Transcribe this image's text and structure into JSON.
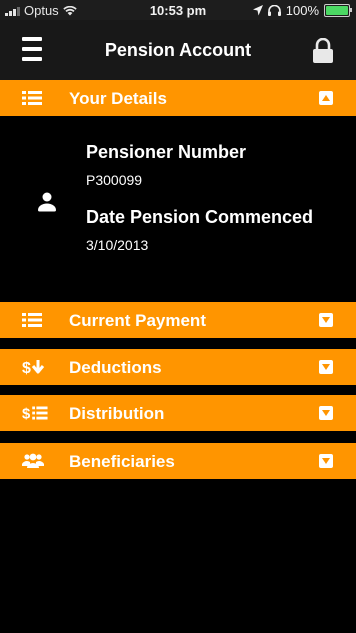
{
  "status_bar": {
    "carrier": "Optus",
    "time": "10:53 pm",
    "battery": "100%"
  },
  "nav": {
    "title": "Pension Account"
  },
  "sections": {
    "your_details": {
      "label": "Your Details",
      "expanded": true,
      "fields": {
        "pensioner_number_label": "Pensioner Number",
        "pensioner_number_value": "P300099",
        "date_commenced_label": "Date Pension Commenced",
        "date_commenced_value": "3/10/2013"
      }
    },
    "current_payment": {
      "label": "Current Payment",
      "expanded": false
    },
    "deductions": {
      "label": "Deductions",
      "expanded": false
    },
    "distribution": {
      "label": "Distribution",
      "expanded": false
    },
    "beneficiaries": {
      "label": "Beneficiaries",
      "expanded": false
    }
  },
  "colors": {
    "accent": "#ff9500",
    "background": "#000000",
    "navbar": "#181818"
  },
  "icons": {
    "menu": "hamburger-icon",
    "lock": "lock-icon",
    "list": "list-icon",
    "deductions": "dollar-down-arrow-icon",
    "distribution": "dollar-list-icon",
    "beneficiaries": "users-icon",
    "person": "user-icon"
  }
}
